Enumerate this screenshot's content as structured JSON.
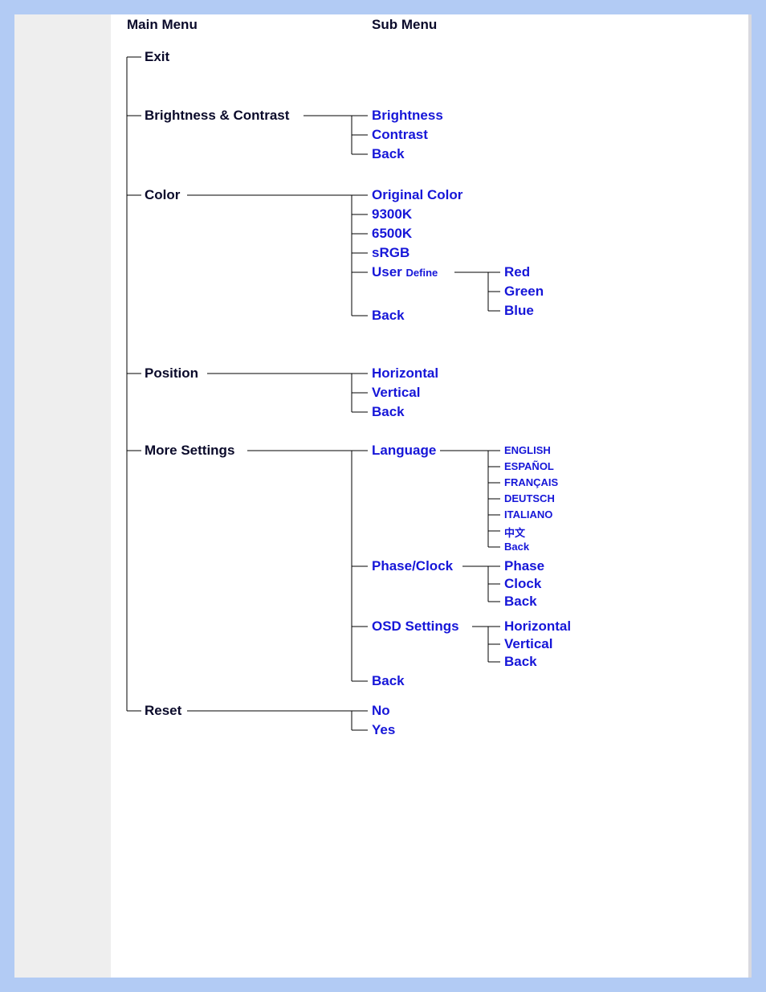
{
  "headers": {
    "main": "Main Menu",
    "sub": "Sub Menu"
  },
  "main": {
    "exit": "Exit",
    "brightness_contrast": "Brightness & Contrast",
    "color": "Color",
    "position": "Position",
    "more_settings": "More Settings",
    "reset": "Reset"
  },
  "sub": {
    "brightness": "Brightness",
    "contrast": "Contrast",
    "back": "Back",
    "original_color": "Original Color",
    "k9300": "9300K",
    "k6500": "6500K",
    "srgb": "sRGB",
    "user": "User",
    "define": "Define",
    "red": "Red",
    "green": "Green",
    "blue": "Blue",
    "horizontal": "Horizontal",
    "vertical": "Vertical",
    "language": "Language",
    "english": "ENGLISH",
    "espanol": "ESPAÑOL",
    "francais": "FRANÇAIS",
    "deutsch": "DEUTSCH",
    "italiano": "ITALIANO",
    "chinese": "中文",
    "phase_clock": "Phase/Clock",
    "phase": "Phase",
    "clock": "Clock",
    "osd_settings": "OSD Settings",
    "no": "No",
    "yes": "Yes"
  }
}
